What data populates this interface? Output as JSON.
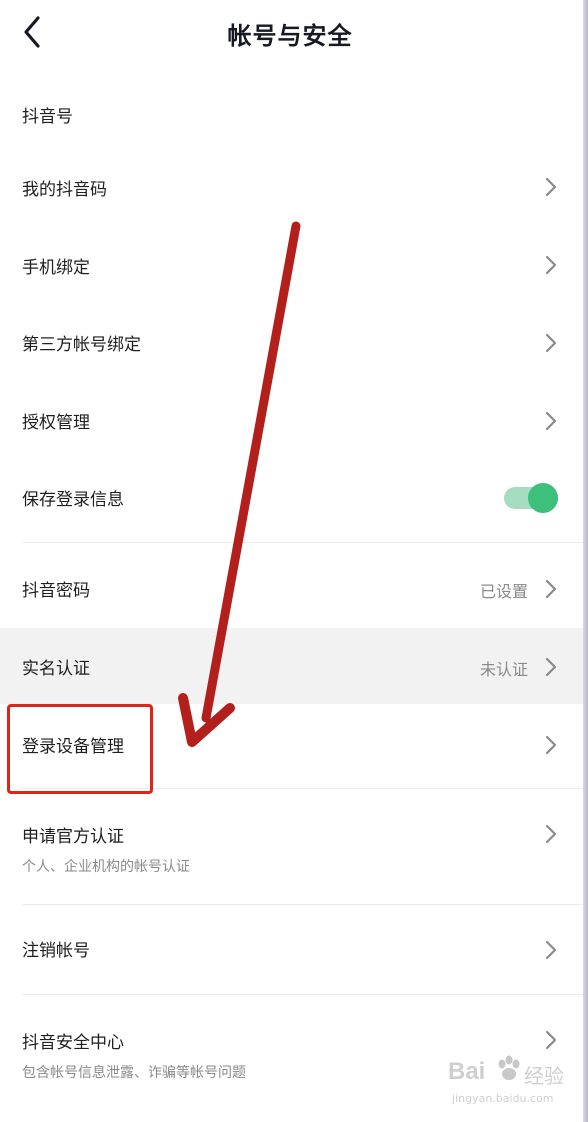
{
  "header": {
    "title": "帐号与安全",
    "back_icon": "chevron-left-icon"
  },
  "settings": {
    "douyin_id": {
      "label": "抖音号"
    },
    "my_qr_code": {
      "label": "我的抖音码"
    },
    "phone_binding": {
      "label": "手机绑定"
    },
    "third_party_binding": {
      "label": "第三方帐号绑定"
    },
    "authorization": {
      "label": "授权管理"
    },
    "save_login_info": {
      "label": "保存登录信息",
      "enabled": true,
      "accent_color": "#3dc07a"
    },
    "password": {
      "label": "抖音密码",
      "value": "已设置"
    },
    "real_name": {
      "label": "实名认证",
      "value": "未认证"
    },
    "login_devices": {
      "label": "登录设备管理"
    },
    "official_verification": {
      "label": "申请官方认证",
      "sub": "个人、企业机构的帐号认证"
    },
    "delete_account": {
      "label": "注销帐号"
    },
    "security_center": {
      "label": "抖音安全中心",
      "sub": "包含帐号信息泄露、诈骗等帐号问题"
    }
  },
  "annotation": {
    "highlight_color": "#e2231a",
    "arrow_color": "#b3201c"
  },
  "watermark": {
    "brand": "Bai",
    "brand_suffix": "经验",
    "domain": "jingyan.baidu.com"
  }
}
